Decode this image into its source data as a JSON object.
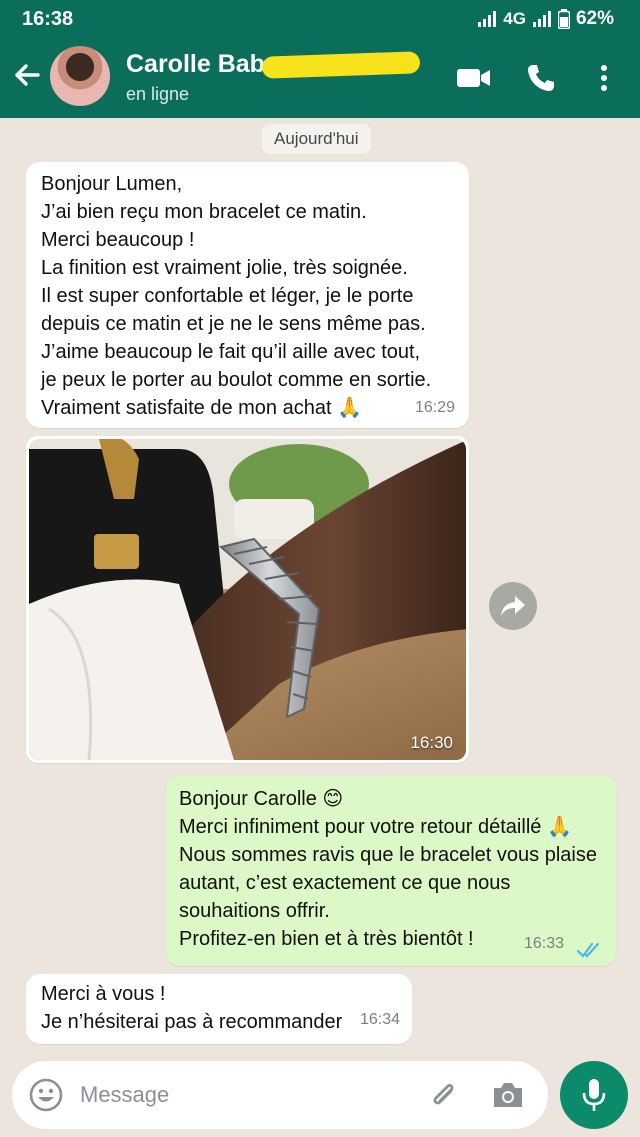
{
  "status_bar": {
    "time": "16:38",
    "network": "4G",
    "battery": "62%"
  },
  "header": {
    "contact_name": "Carolle Baba",
    "presence": "en ligne"
  },
  "chat": {
    "date_chip": "Aujourd'hui",
    "messages": [
      {
        "direction": "incoming",
        "lines": [
          "Bonjour Lumen,",
          "J’ai bien reçu mon bracelet ce matin.",
          "Merci beaucoup !",
          "La finition est vraiment jolie, très soignée.",
          "Il est super confortable et léger, je le porte",
          "depuis ce matin et je ne le sens même pas.",
          "J’aime beaucoup le fait qu’il aille avec tout,",
          "je peux le porter au boulot comme en sortie.",
          "Vraiment satisfaite de mon achat 🙏"
        ],
        "time": "16:29"
      },
      {
        "direction": "incoming",
        "type": "image",
        "time": "16:30"
      },
      {
        "direction": "outgoing",
        "lines": [
          "Bonjour Carolle 😊",
          "Merci infiniment pour votre retour détaillé 🙏",
          "Nous sommes ravis que le bracelet vous plaise",
          "autant, c’est exactement ce que nous",
          "souhaitions offrir.",
          "Profitez-en bien et à très bientôt !"
        ],
        "time": "16:33",
        "status": "read"
      },
      {
        "direction": "incoming",
        "lines": [
          "Merci à vous !",
          "Je n’hésiterai pas à recommander"
        ],
        "time": "16:34"
      }
    ]
  },
  "composer": {
    "placeholder": "Message"
  },
  "icons": {
    "back": "arrow-left-icon",
    "video": "video-camera-icon",
    "call": "phone-icon",
    "menu": "more-vertical-icon",
    "forward": "forward-icon",
    "emoji": "emoji-icon",
    "attach": "paperclip-icon",
    "camera": "camera-icon",
    "mic": "microphone-icon"
  },
  "colors": {
    "header": "#0b6e5b",
    "chat_background": "#ece5dd",
    "incoming_bubble": "#ffffff",
    "outgoing_bubble": "#dcf8c6",
    "read_ticks": "#4fb6ec",
    "mic_button": "#0b8a6c",
    "redaction": "#f7e21b"
  }
}
